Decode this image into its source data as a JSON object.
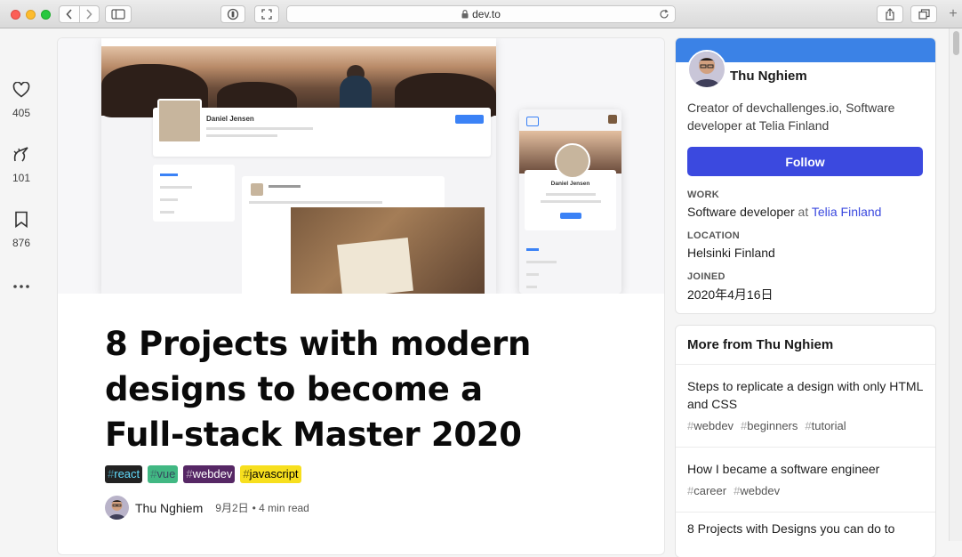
{
  "browser": {
    "url": "dev.to",
    "icons": {
      "back": "chevron-left-icon",
      "forward": "chevron-right-icon",
      "sidebar": "sidebar-icon",
      "privacy": "shield-icon",
      "resize": "expand-icon",
      "share": "share-icon",
      "tabs": "tabs-icon",
      "new_tab": "+"
    }
  },
  "reactions": [
    {
      "icon": "heart-icon",
      "count": "405"
    },
    {
      "icon": "unicorn-icon",
      "count": "101"
    },
    {
      "icon": "bookmark-icon",
      "count": "876"
    }
  ],
  "article": {
    "title": "8 Projects with modern designs to become a Full-stack Master 2020",
    "tags": [
      {
        "hash": "#",
        "name": "react",
        "bg": "#222222",
        "color": "#61dafb"
      },
      {
        "hash": "#",
        "name": "vue",
        "bg": "#41b883",
        "color": "#35495e"
      },
      {
        "hash": "#",
        "name": "webdev",
        "bg": "#562765",
        "color": "#ffffff"
      },
      {
        "hash": "#",
        "name": "javascript",
        "bg": "#f7df1e",
        "color": "#000000"
      }
    ],
    "author": "Thu Nghiem",
    "date": "9月2日",
    "read_time": "• 4 min read"
  },
  "cover_mock": {
    "profile_name": "Daniel Jensen",
    "follow": "Follow",
    "phone_name": "Daniel Jensen"
  },
  "profile": {
    "name": "Thu Nghiem",
    "bio": "Creator of devchallenges.io, Software developer at Telia Finland",
    "follow_label": "Follow",
    "work_label": "WORK",
    "work_role": "Software developer",
    "work_at": "at",
    "work_company": "Telia Finland",
    "location_label": "LOCATION",
    "location": "Helsinki Finland",
    "joined_label": "JOINED",
    "joined": "2020年4月16日",
    "strip_color": "#3b82e6",
    "button_color": "#3b49df"
  },
  "more_from": {
    "heading": "More from Thu Nghiem",
    "posts": [
      {
        "title": "Steps to replicate a design with only HTML and CSS",
        "tags": [
          "webdev",
          "beginners",
          "tutorial"
        ]
      },
      {
        "title": "How I became a software engineer",
        "tags": [
          "career",
          "webdev"
        ]
      },
      {
        "title": "8 Projects with Designs you can do to",
        "tags": []
      }
    ]
  }
}
